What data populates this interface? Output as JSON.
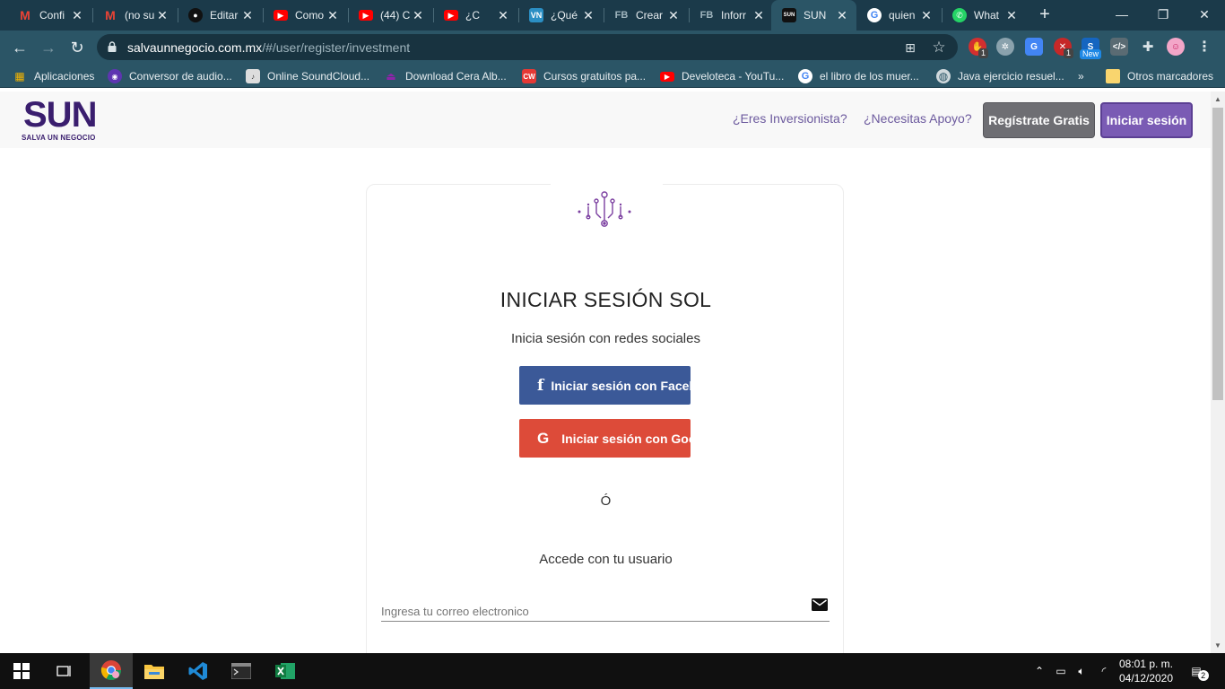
{
  "tabs": [
    {
      "title": "Confi",
      "fav": "gmail-icon"
    },
    {
      "title": "(no su",
      "fav": "gmail-icon"
    },
    {
      "title": "Editar",
      "fav": "github-icon"
    },
    {
      "title": "Como",
      "fav": "youtube-icon"
    },
    {
      "title": "(44) C",
      "fav": "youtube-icon"
    },
    {
      "title": "¿C",
      "fav": "youtube-icon"
    },
    {
      "title": "¿Qué",
      "fav": "vn-icon"
    },
    {
      "title": "Crear",
      "fav": "fb-icon"
    },
    {
      "title": "Inforr",
      "fav": "fb-icon"
    },
    {
      "title": "SUN",
      "fav": "sun-icon",
      "active": true
    },
    {
      "title": "quien",
      "fav": "google-icon"
    },
    {
      "title": "What",
      "fav": "whatsapp-icon"
    }
  ],
  "browser": {
    "url_host": "salvaunnegocio.com.mx",
    "url_path": "/#/user/register/investment"
  },
  "bookmarks": [
    {
      "label": "Aplicaciones",
      "icon": "apps-grid-icon"
    },
    {
      "label": "Conversor de audio...",
      "icon": "audio-converter-icon"
    },
    {
      "label": "Online SoundCloud...",
      "icon": "soundcloud-icon"
    },
    {
      "label": "Download Cera Alb...",
      "icon": "download-icon"
    },
    {
      "label": "Cursos gratuitos pa...",
      "icon": "courses-icon"
    },
    {
      "label": "Develoteca - YouTu...",
      "icon": "youtube-icon"
    },
    {
      "label": "el libro de los muer...",
      "icon": "google-icon"
    },
    {
      "label": "Java ejercicio resuel...",
      "icon": "globe-icon"
    }
  ],
  "bookmarks_other": "Otros marcadores",
  "extensions": {
    "badge_1": "1",
    "badge_2": "1",
    "badge_new": "New"
  },
  "site": {
    "logo_title": "SUN",
    "logo_subtitle": "SALVA UN NEGOCIO",
    "nav": {
      "investor": "¿Eres Inversionista?",
      "support": "¿Necesitas Apoyo?",
      "register": "Regístrate Gratis",
      "login": "Iniciar sesión"
    }
  },
  "login_card": {
    "title": "INICIAR SESIÓN SOL",
    "social_prompt": "Inicia sesión con redes sociales",
    "facebook_button": "Iniciar sesión con Facebook",
    "google_button": "Iniciar sesión con Google",
    "or_text": "Ó",
    "user_prompt": "Accede con tu usuario",
    "email_placeholder": "Ingresa tu correo electronico"
  },
  "taskbar": {
    "time": "08:01 p. m.",
    "date": "04/12/2020",
    "notifications": "2"
  },
  "colors": {
    "brand": "#3a1e6e",
    "facebook": "#3b5998",
    "google": "#dd4b39",
    "register_button": "#6e6e73",
    "login_button": "#7a5bb4"
  }
}
